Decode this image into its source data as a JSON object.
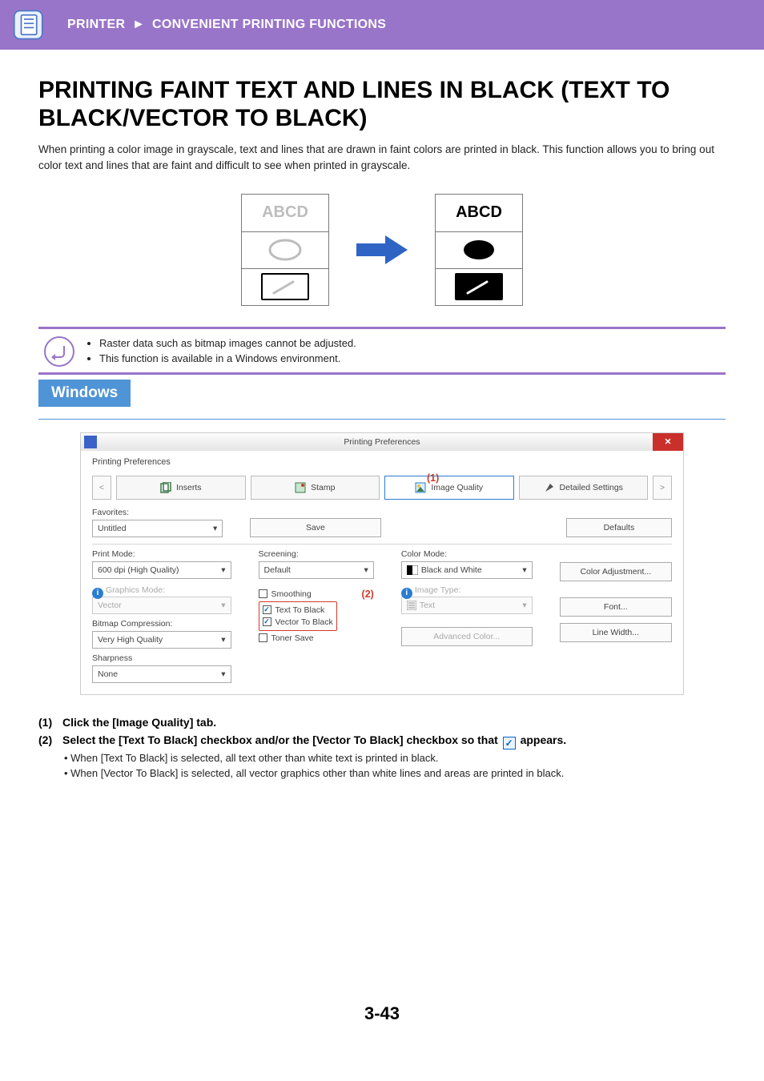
{
  "header": {
    "breadcrumb_a": "PRINTER",
    "arrow": "►",
    "breadcrumb_b": "CONVENIENT PRINTING FUNCTIONS"
  },
  "title": "PRINTING FAINT TEXT AND LINES IN BLACK (TEXT TO BLACK/VECTOR TO BLACK)",
  "intro": "When printing a color image in grayscale, text and lines that are drawn in faint colors are printed in black. This function allows you to bring out color text and lines that are faint and difficult to see when printed in grayscale.",
  "illustration": {
    "sample_text": "ABCD"
  },
  "notes": {
    "n1": "Raster data such as bitmap images cannot be adjusted.",
    "n2": "This function is available in a Windows environment."
  },
  "win_tag": "Windows",
  "screenshot": {
    "window_title": "Printing Preferences",
    "pref_tab_label": "Printing Preferences",
    "tabs": {
      "inserts": "Inserts",
      "stamp": "Stamp",
      "image_quality": "Image Quality",
      "detailed": "Detailed Settings"
    },
    "favorites_label": "Favorites:",
    "favorites_value": "Untitled",
    "save_btn": "Save",
    "defaults_btn": "Defaults",
    "print_mode_label": "Print Mode:",
    "print_mode_value": "600 dpi (High Quality)",
    "screening_label": "Screening:",
    "screening_value": "Default",
    "color_mode_label": "Color Mode:",
    "color_mode_value": "Black and White",
    "color_adj_btn": "Color Adjustment...",
    "graphics_mode_label": "Graphics Mode:",
    "graphics_mode_value": "Vector",
    "bitmap_label": "Bitmap Compression:",
    "bitmap_value": "Very High Quality",
    "sharpness_label": "Sharpness",
    "sharpness_value": "None",
    "smoothing": "Smoothing",
    "text_to_black": "Text To Black",
    "vector_to_black": "Vector To Black",
    "toner_save": "Toner Save",
    "image_type_label": "Image Type:",
    "image_type_value": "Text",
    "adv_color_btn": "Advanced Color...",
    "font_btn": "Font...",
    "line_btn": "Line Width...",
    "callout1": "(1)",
    "callout2": "(2)"
  },
  "steps": {
    "s1_num": "(1)",
    "s1_text": "Click the [Image Quality] tab.",
    "s2_num": "(2)",
    "s2_text_a": "Select the [Text To Black] checkbox and/or the [Vector To Black] checkbox so that ",
    "s2_text_b": " appears.",
    "s2_sub1": "• When [Text To Black] is selected, all text other than white text is printed in black.",
    "s2_sub2": "• When [Vector To Black] is selected, all vector graphics other than white lines and areas are printed in black."
  },
  "page_number": "3-43"
}
